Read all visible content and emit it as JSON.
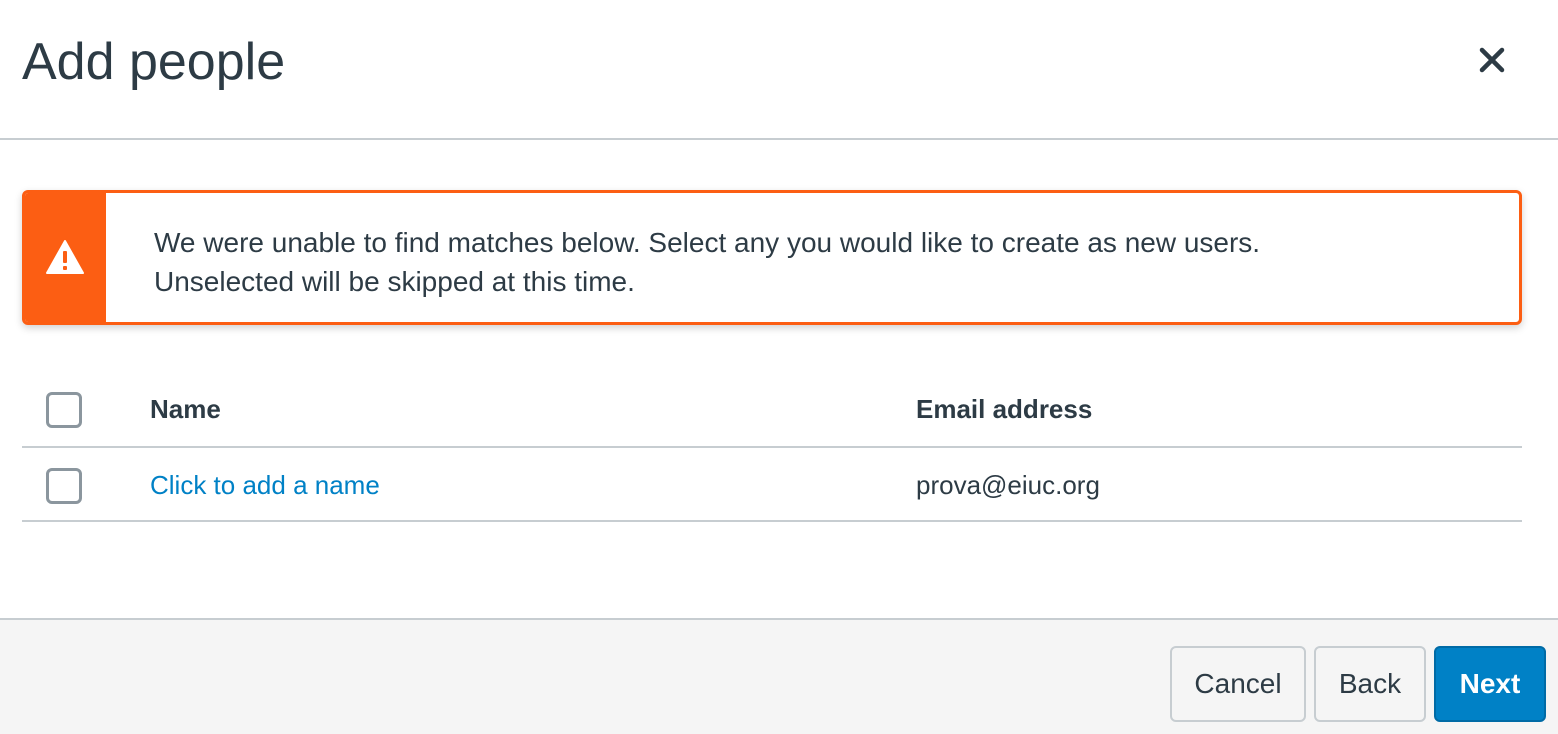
{
  "modal": {
    "title": "Add people"
  },
  "alert": {
    "line1": "We were unable to find matches below. Select any you would like to create as new users.",
    "line2": "Unselected will be skipped at this time.",
    "color": "#fc5e13",
    "icon": "warning-icon"
  },
  "table": {
    "headers": {
      "name": "Name",
      "email": "Email address"
    },
    "rows": [
      {
        "name_link": "Click to add a name",
        "email": "prova@eiuc.org",
        "selected": false
      }
    ]
  },
  "footer": {
    "cancel_label": "Cancel",
    "back_label": "Back",
    "next_label": "Next"
  },
  "colors": {
    "text": "#2d3b45",
    "link": "#0081c6",
    "primary_button": "#0081c6",
    "warning": "#fc5e13",
    "border": "#c7cdd1",
    "footer_bg": "#f5f5f5"
  }
}
